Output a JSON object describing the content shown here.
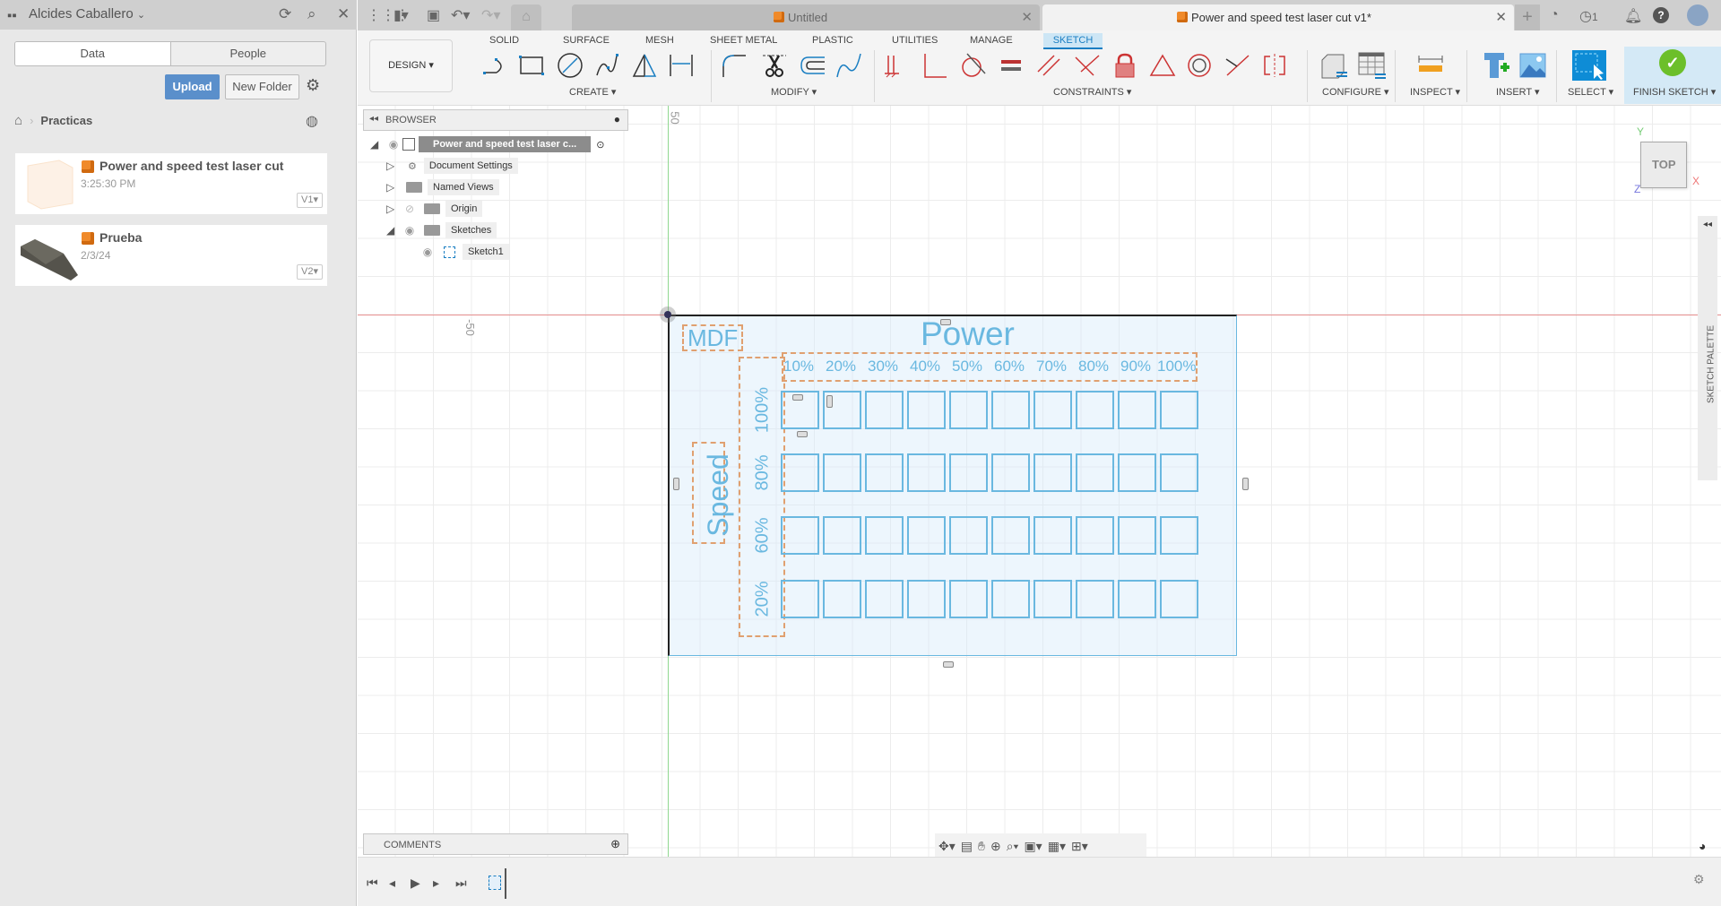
{
  "data_panel": {
    "user_name": "Alcides Caballero",
    "tabs": [
      {
        "label": "Data",
        "active": true
      },
      {
        "label": "People",
        "active": false
      }
    ],
    "upload_label": "Upload",
    "new_folder_label": "New Folder",
    "breadcrumb": {
      "folder": "Practicas"
    },
    "files": [
      {
        "name": "Power and speed test laser cut",
        "date": "3:25:30 PM",
        "version": "V1▾"
      },
      {
        "name": "Prueba",
        "date": "2/3/24",
        "version": "V2▾"
      }
    ]
  },
  "tabs": {
    "untitled": "Untitled",
    "document": "Power and speed test laser cut v1*",
    "job_count": "1"
  },
  "ribbon": {
    "workspace": "DESIGN ▾",
    "tabs": [
      "SOLID",
      "SURFACE",
      "MESH",
      "SHEET METAL",
      "PLASTIC",
      "UTILITIES",
      "MANAGE",
      "SKETCH"
    ],
    "active_tab": "SKETCH",
    "groups": {
      "create": "CREATE ▾",
      "modify": "MODIFY ▾",
      "constraints": "CONSTRAINTS ▾",
      "configure": "CONFIGURE ▾",
      "inspect": "INSPECT ▾",
      "insert": "INSERT ▾",
      "select": "SELECT ▾",
      "finish": "FINISH SKETCH ▾"
    }
  },
  "browser": {
    "title": "BROWSER",
    "root": "Power and speed test laser c...",
    "nodes": [
      "Document Settings",
      "Named Views",
      "Origin",
      "Sketches",
      "Sketch1"
    ]
  },
  "canvas": {
    "axis_labels": {
      "y_top": "50",
      "x_left": "-50"
    },
    "viewcube": "TOP",
    "axes": {
      "x": "X",
      "y": "Y",
      "z": "Z"
    },
    "sketch_palette": "SKETCH PALETTE",
    "sketch_texts": {
      "material": "MDF",
      "power_title": "Power",
      "speed_title": "Speed",
      "power_levels": [
        "10%",
        "20%",
        "30%",
        "40%",
        "50%",
        "60%",
        "70%",
        "80%",
        "90%",
        "100%"
      ],
      "speed_levels": [
        "100%",
        "80%",
        "60%",
        "20%"
      ]
    }
  },
  "comments": {
    "label": "COMMENTS"
  },
  "colors": {
    "accent": "#1a7ec2",
    "sketch_line": "#6ab8e0",
    "text_box": "#e0a070",
    "finish_ok": "#6cbf2a"
  }
}
